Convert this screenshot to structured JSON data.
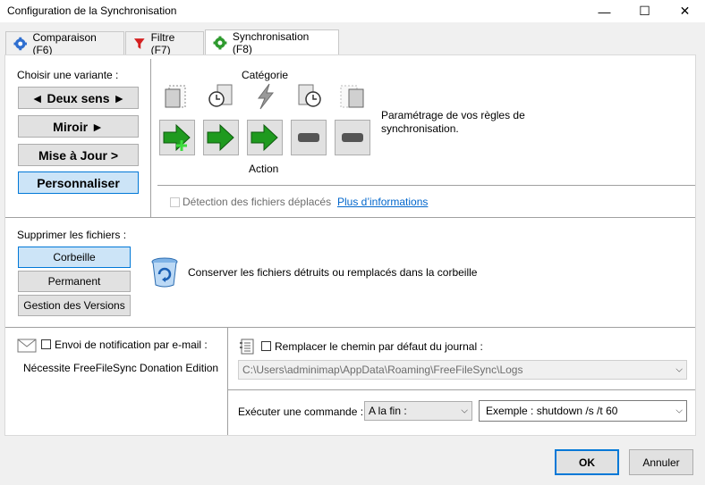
{
  "window": {
    "title": "Configuration de la Synchronisation"
  },
  "tabs": [
    {
      "label": "Comparaison (F6)",
      "icon": "gear-blue-icon"
    },
    {
      "label": "Filtre (F7)",
      "icon": "funnel-icon"
    },
    {
      "label": "Synchronisation (F8)",
      "icon": "gear-green-icon"
    }
  ],
  "variant": {
    "heading": "Choisir une variante :",
    "options": [
      "◄ Deux sens ►",
      "Miroir ►",
      "Mise à Jour >",
      "Personnaliser"
    ],
    "selected": "Personnaliser"
  },
  "category": {
    "label": "Catégorie",
    "action_label": "Action",
    "description": "Paramétrage de vos règles de synchronisation."
  },
  "detect_moved": {
    "label": "Détection des fichiers déplacés",
    "link": "Plus d’informations"
  },
  "deletion": {
    "heading": "Supprimer les fichiers :",
    "options": [
      "Corbeille",
      "Permanent",
      "Gestion des Versions"
    ],
    "selected": "Corbeille",
    "description": "Conserver les fichiers détruits ou remplacés dans la corbeille"
  },
  "email": {
    "label": "Envoi de notification par e-mail :",
    "note": "Nécessite FreeFileSync Donation Edition"
  },
  "log": {
    "label": "Remplacer le chemin par défaut du journal :",
    "path": "C:\\Users\\adminimap\\AppData\\Roaming\\FreeFileSync\\Logs"
  },
  "command": {
    "label": "Exécuter une commande :",
    "when": "A la fin :",
    "placeholder": "Exemple : shutdown /s /t 60"
  },
  "footer": {
    "ok": "OK",
    "cancel": "Annuler"
  },
  "colors": {
    "selected_bg": "#cce4f7",
    "selected_border": "#0078d7",
    "link": "#0066cc",
    "arrow_green": "#1f9a1f"
  }
}
